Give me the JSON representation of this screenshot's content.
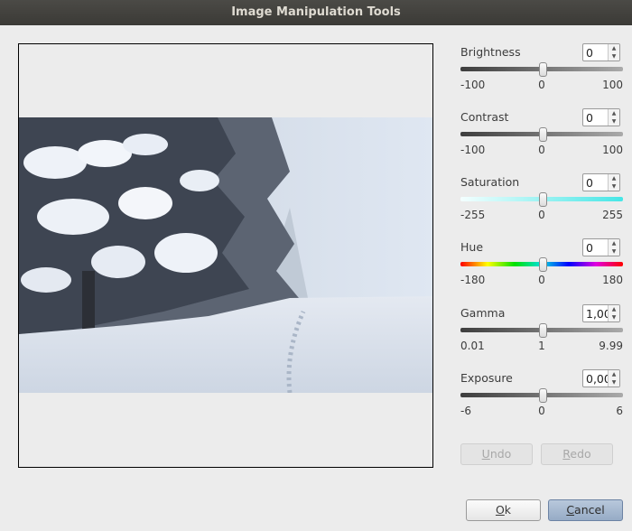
{
  "window": {
    "title": "Image Manipulation Tools"
  },
  "controls": [
    {
      "key": "brightness",
      "label": "Brightness",
      "value": "0",
      "min": "-100",
      "mid": "0",
      "max": "100",
      "position": 0.5,
      "track": "gray"
    },
    {
      "key": "contrast",
      "label": "Contrast",
      "value": "0",
      "min": "-100",
      "mid": "0",
      "max": "100",
      "position": 0.5,
      "track": "gray"
    },
    {
      "key": "saturation",
      "label": "Saturation",
      "value": "0",
      "min": "-255",
      "mid": "0",
      "max": "255",
      "position": 0.5,
      "track": "saturation"
    },
    {
      "key": "hue",
      "label": "Hue",
      "value": "0",
      "min": "-180",
      "mid": "0",
      "max": "180",
      "position": 0.5,
      "track": "hue"
    },
    {
      "key": "gamma",
      "label": "Gamma",
      "value": "1,00",
      "min": "0.01",
      "mid": "1",
      "max": "9.99",
      "position": 0.5,
      "track": "gray"
    },
    {
      "key": "exposure",
      "label": "Exposure",
      "value": "0,00",
      "min": "-6",
      "mid": "0",
      "max": "6",
      "position": 0.5,
      "track": "gray"
    }
  ],
  "buttons": {
    "undo": {
      "mnemonic": "U",
      "rest": "ndo"
    },
    "redo": {
      "mnemonic": "R",
      "rest": "edo"
    },
    "ok": {
      "mnemonic": "O",
      "rest": "k"
    },
    "cancel": {
      "mnemonic": "C",
      "rest": "ancel"
    }
  },
  "preview": {
    "subject": "snowy forest road in fog"
  },
  "colors": {
    "titlebar": "#3c3b37",
    "default_button": "#9db1cb",
    "background": "#ececec"
  }
}
